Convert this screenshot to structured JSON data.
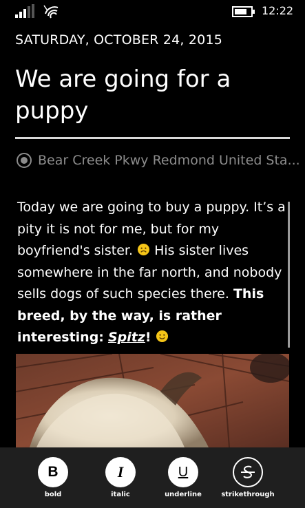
{
  "status_bar": {
    "time": "12:22",
    "signal_icon": "signal-bars-icon",
    "wifi_icon": "wifi-icon",
    "battery_icon": "battery-icon"
  },
  "entry": {
    "date": "SATURDAY, OCTOBER 24, 2015",
    "title": "We are going for a puppy",
    "location_icon": "location-radio-icon",
    "location": "Bear Creek Pkwy Redmond United Sta...",
    "body": {
      "p1": "Today we are going to buy a puppy. It’s a pity it is not for me, but for my boyfriend's sister.",
      "emoji1": "☹",
      "p2": "His sister lives somewhere in the far north, and nobody sells dogs of such species there.",
      "bold_text": "This breed, by the way, is rather interesting:",
      "bold_italic_link": "Spitz",
      "bold_end": "!",
      "emoji2": "☺"
    },
    "photo_description": "puppy-photo"
  },
  "app_bar": {
    "buttons": [
      {
        "glyph": "B",
        "label": "bold",
        "icon": "bold-icon"
      },
      {
        "glyph": "I",
        "label": "italic",
        "icon": "italic-icon"
      },
      {
        "glyph": "U",
        "label": "underline",
        "icon": "underline-icon"
      },
      {
        "glyph": "S",
        "label": "strikethrough",
        "icon": "strikethrough-icon"
      }
    ]
  },
  "colors": {
    "background": "#000000",
    "app_bar": "#1f1f1f",
    "muted_text": "#8c8c8c",
    "emoji_yellow": "#f5c518"
  }
}
